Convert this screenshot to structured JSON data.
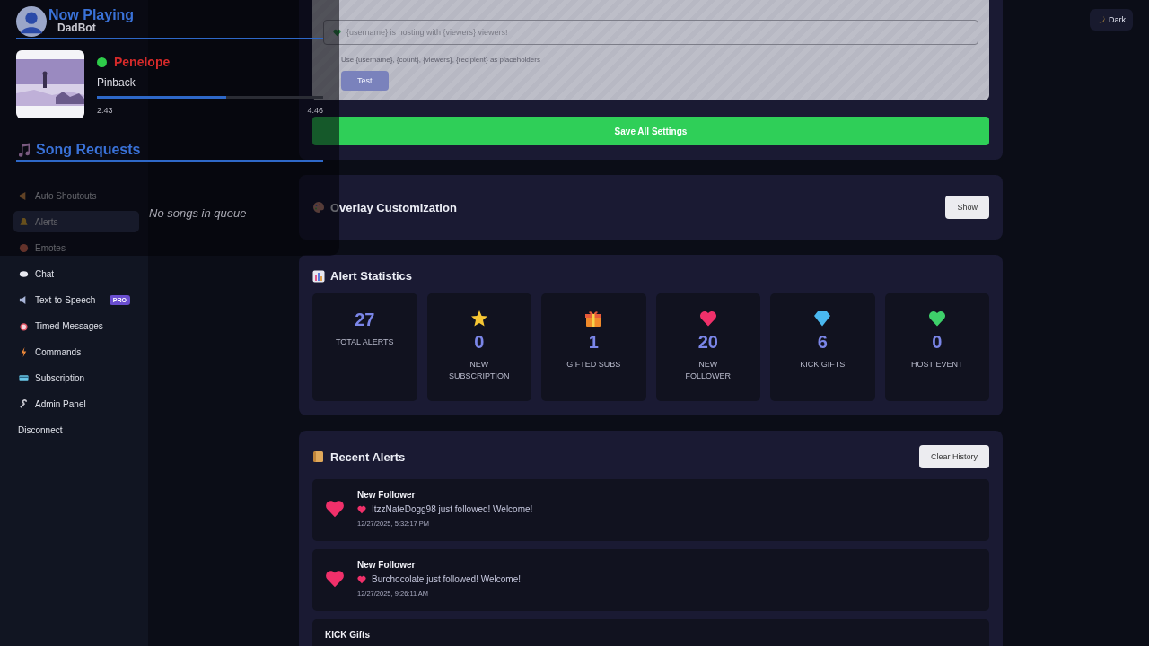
{
  "overlay": {
    "now_playing": {
      "title": "Now Playing",
      "subtitle": "DadBot",
      "playing": true,
      "track": "Penelope",
      "artist": "Pinback",
      "level": 0.57,
      "elapsed": "2:43",
      "duration": "4:46"
    },
    "song_requests": {
      "title": "Song Requests",
      "empty": "No songs in queue"
    }
  },
  "theme_toggle": "Dark",
  "sidebar": {
    "items": [
      {
        "label": "Auto Shoutouts",
        "selected": false
      },
      {
        "label": "Alerts",
        "selected": true
      },
      {
        "label": "Emotes",
        "selected": false
      },
      {
        "label": "Chat",
        "selected": false
      },
      {
        "label": "Text-to-Speech",
        "badge": "PRO",
        "selected": false
      },
      {
        "label": "Timed Messages",
        "selected": false
      },
      {
        "label": "Commands",
        "selected": false
      },
      {
        "label": "Subscription",
        "selected": false
      },
      {
        "label": "Admin Panel",
        "selected": false
      }
    ],
    "disconnect": "Disconnect"
  },
  "host_settings": {
    "disabled": true,
    "message": "{username} is hosting with {viewers} viewers!",
    "hint": "Use {username}, {count}, {viewers}, {recipient} as placeholders",
    "test_button": "Test"
  },
  "save_button": "Save All Settings",
  "overlay_customization": {
    "title": "Overlay Customization",
    "button": "Show"
  },
  "alert_statistics": {
    "title": "Alert Statistics",
    "stats": [
      {
        "value": "27",
        "label": "TOTAL ALERTS"
      },
      {
        "value": "0",
        "label": "NEW SUBSCRIPTION"
      },
      {
        "value": "1",
        "label": "GIFTED SUBS"
      },
      {
        "value": "20",
        "label": "NEW FOLLOWER"
      },
      {
        "value": "6",
        "label": "KICK GIFTS"
      },
      {
        "value": "0",
        "label": "HOST EVENT"
      }
    ]
  },
  "recent_alerts": {
    "title": "Recent Alerts",
    "button": "Clear History",
    "items": [
      {
        "title": "New Follower",
        "message": "ItzzNateDogg98 just followed! Welcome!",
        "time": "12/27/2025, 5:32:17 PM"
      },
      {
        "title": "New Follower",
        "message": "Burchocolate just followed! Welcome!",
        "time": "12/27/2025, 9:26:11 AM"
      },
      {
        "title": "KICK Gifts"
      }
    ]
  }
}
